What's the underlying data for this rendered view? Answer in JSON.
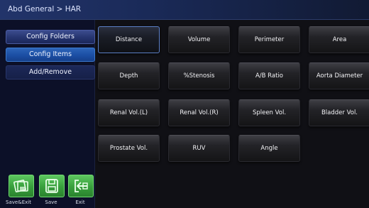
{
  "header": {
    "breadcrumb": "Abd General > HAR"
  },
  "sidebar": {
    "items": [
      {
        "label": "Config Folders"
      },
      {
        "label": "Config Items"
      },
      {
        "label": "Add/Remove"
      }
    ]
  },
  "toolbar": {
    "save_exit_label": "Save&Exit",
    "save_label": "Save",
    "exit_label": "Exit",
    "accent_color": "#3aa23e"
  },
  "items": [
    "Distance",
    "Volume",
    "Perimeter",
    "Area",
    "Depth",
    "%Stenosis",
    "A/B Ratio",
    "Aorta Diameter",
    "Renal Vol.(L)",
    "Renal Vol.(R)",
    "Spleen Vol.",
    "Bladder Vol.",
    "Prostate Vol.",
    "RUV",
    "Angle"
  ],
  "selected_item": "Distance"
}
